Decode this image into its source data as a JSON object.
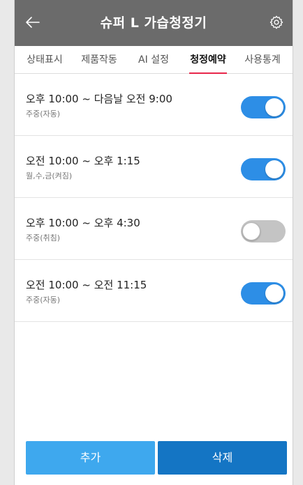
{
  "header": {
    "title": "슈퍼 L 가습청정기",
    "back_icon": "arrow-left-icon",
    "settings_icon": "gear-icon"
  },
  "tabs": [
    {
      "label": "상태표시",
      "active": false
    },
    {
      "label": "제품작동",
      "active": false
    },
    {
      "label": "AI 설정",
      "active": false
    },
    {
      "label": "청정예약",
      "active": true
    },
    {
      "label": "사용통계",
      "active": false
    }
  ],
  "schedules": [
    {
      "time": "오후 10:00 ~ 다음날 오전 9:00",
      "detail": "주중(자동)",
      "enabled": true
    },
    {
      "time": "오전 10:00 ~ 오후 1:15",
      "detail": "월,수,금(켜짐)",
      "enabled": true
    },
    {
      "time": "오후 10:00 ~ 오후 4:30",
      "detail": "주중(취침)",
      "enabled": false
    },
    {
      "time": "오전 10:00 ~ 오전 11:15",
      "detail": "주중(자동)",
      "enabled": true
    }
  ],
  "actions": {
    "add_label": "추가",
    "delete_label": "삭제"
  },
  "colors": {
    "header_bg": "#6b6b6b",
    "active_tab_underline": "#e8264a",
    "toggle_on": "#2d8ee6",
    "toggle_off": "#c4c4c4",
    "add_button": "#3ea8ee",
    "delete_button": "#1475c4"
  }
}
